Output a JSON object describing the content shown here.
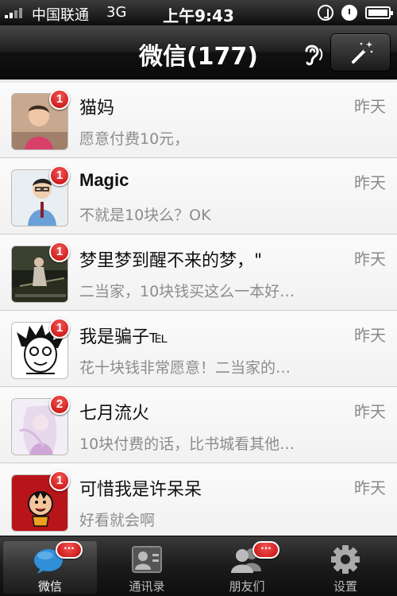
{
  "status_bar": {
    "carrier": "中国联通",
    "network": "3G",
    "time": "上午9:43"
  },
  "nav": {
    "title": "微信(177)",
    "ear_icon": "ear-icon",
    "magic_icon": "magic-wand-icon"
  },
  "chats": [
    {
      "name": "猫妈",
      "time": "昨天",
      "preview": "愿意付费10元，",
      "badge": "1"
    },
    {
      "name": "Magic",
      "time": "昨天",
      "preview": "不就是10块么？OK",
      "badge": "1"
    },
    {
      "name": "梦里梦到醒不来的梦，\"",
      "time": "昨天",
      "preview": "二当家，10块钱买这么一本好…",
      "badge": "1"
    },
    {
      "name": "我是骗子℡",
      "time": "昨天",
      "preview": "花十块钱非常愿意！二当家的…",
      "badge": "1"
    },
    {
      "name": "七月流火",
      "time": "昨天",
      "preview": "10块付费的话，比书城看其他…",
      "badge": "2"
    },
    {
      "name": "可惜我是许呆呆",
      "time": "昨天",
      "preview": "好看就会啊",
      "badge": "1"
    }
  ],
  "tabs": [
    {
      "label": "微信",
      "icon": "chat-bubble-icon",
      "badge": "···"
    },
    {
      "label": "通讯录",
      "icon": "contacts-icon"
    },
    {
      "label": "朋友们",
      "icon": "friends-icon",
      "badge": "···"
    },
    {
      "label": "设置",
      "icon": "gear-icon"
    }
  ],
  "colors": {
    "badge_red": "#d81c1c",
    "nav_dark": "#1f1f1f",
    "chat_bubble_blue": "#2f8fd8"
  }
}
